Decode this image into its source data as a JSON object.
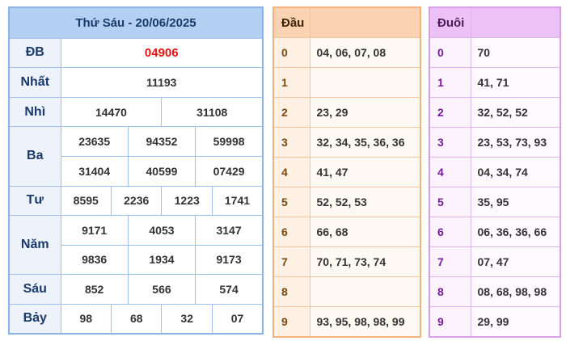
{
  "results": {
    "title": "Thứ Sáu - 20/06/2025",
    "db_label": "ĐB",
    "db": "04906",
    "nhat_label": "Nhất",
    "nhat": "11193",
    "nhi_label": "Nhì",
    "nhi": [
      "14470",
      "31108"
    ],
    "ba_label": "Ba",
    "ba": [
      "23635",
      "94352",
      "59998",
      "31404",
      "40599",
      "07429"
    ],
    "tu_label": "Tư",
    "tu": [
      "8595",
      "2236",
      "1223",
      "1741"
    ],
    "nam_label": "Năm",
    "nam": [
      "9171",
      "4053",
      "3147",
      "9836",
      "1934",
      "9173"
    ],
    "sau_label": "Sáu",
    "sau": [
      "852",
      "566",
      "574"
    ],
    "bay_label": "Bảy",
    "bay": [
      "98",
      "68",
      "32",
      "07"
    ]
  },
  "dau": {
    "header": "Đầu",
    "rows": [
      {
        "key": "0",
        "values": "04, 06, 07, 08"
      },
      {
        "key": "1",
        "values": ""
      },
      {
        "key": "2",
        "values": "23, 29"
      },
      {
        "key": "3",
        "values": "32, 34, 35, 36, 36"
      },
      {
        "key": "4",
        "values": "41, 47"
      },
      {
        "key": "5",
        "values": "52, 52, 53"
      },
      {
        "key": "6",
        "values": "66, 68"
      },
      {
        "key": "7",
        "values": "70, 71, 73, 74"
      },
      {
        "key": "8",
        "values": ""
      },
      {
        "key": "9",
        "values": "93, 95, 98, 98, 99"
      }
    ]
  },
  "duoi": {
    "header": "Đuôi",
    "rows": [
      {
        "key": "0",
        "values": "70"
      },
      {
        "key": "1",
        "values": "41, 71"
      },
      {
        "key": "2",
        "values": "32, 52, 52"
      },
      {
        "key": "3",
        "values": "23, 53, 73, 93"
      },
      {
        "key": "4",
        "values": "04, 34, 74"
      },
      {
        "key": "5",
        "values": "35, 95"
      },
      {
        "key": "6",
        "values": "06, 36, 36, 66"
      },
      {
        "key": "7",
        "values": "07, 47"
      },
      {
        "key": "8",
        "values": "08, 68, 98, 98"
      },
      {
        "key": "9",
        "values": "29, 99"
      }
    ]
  },
  "colors": {
    "blue_header": "#b3d0f3",
    "special_prize": "#e81010",
    "orange_header": "#fbd3b2",
    "pink_header": "#ecc1f5"
  }
}
